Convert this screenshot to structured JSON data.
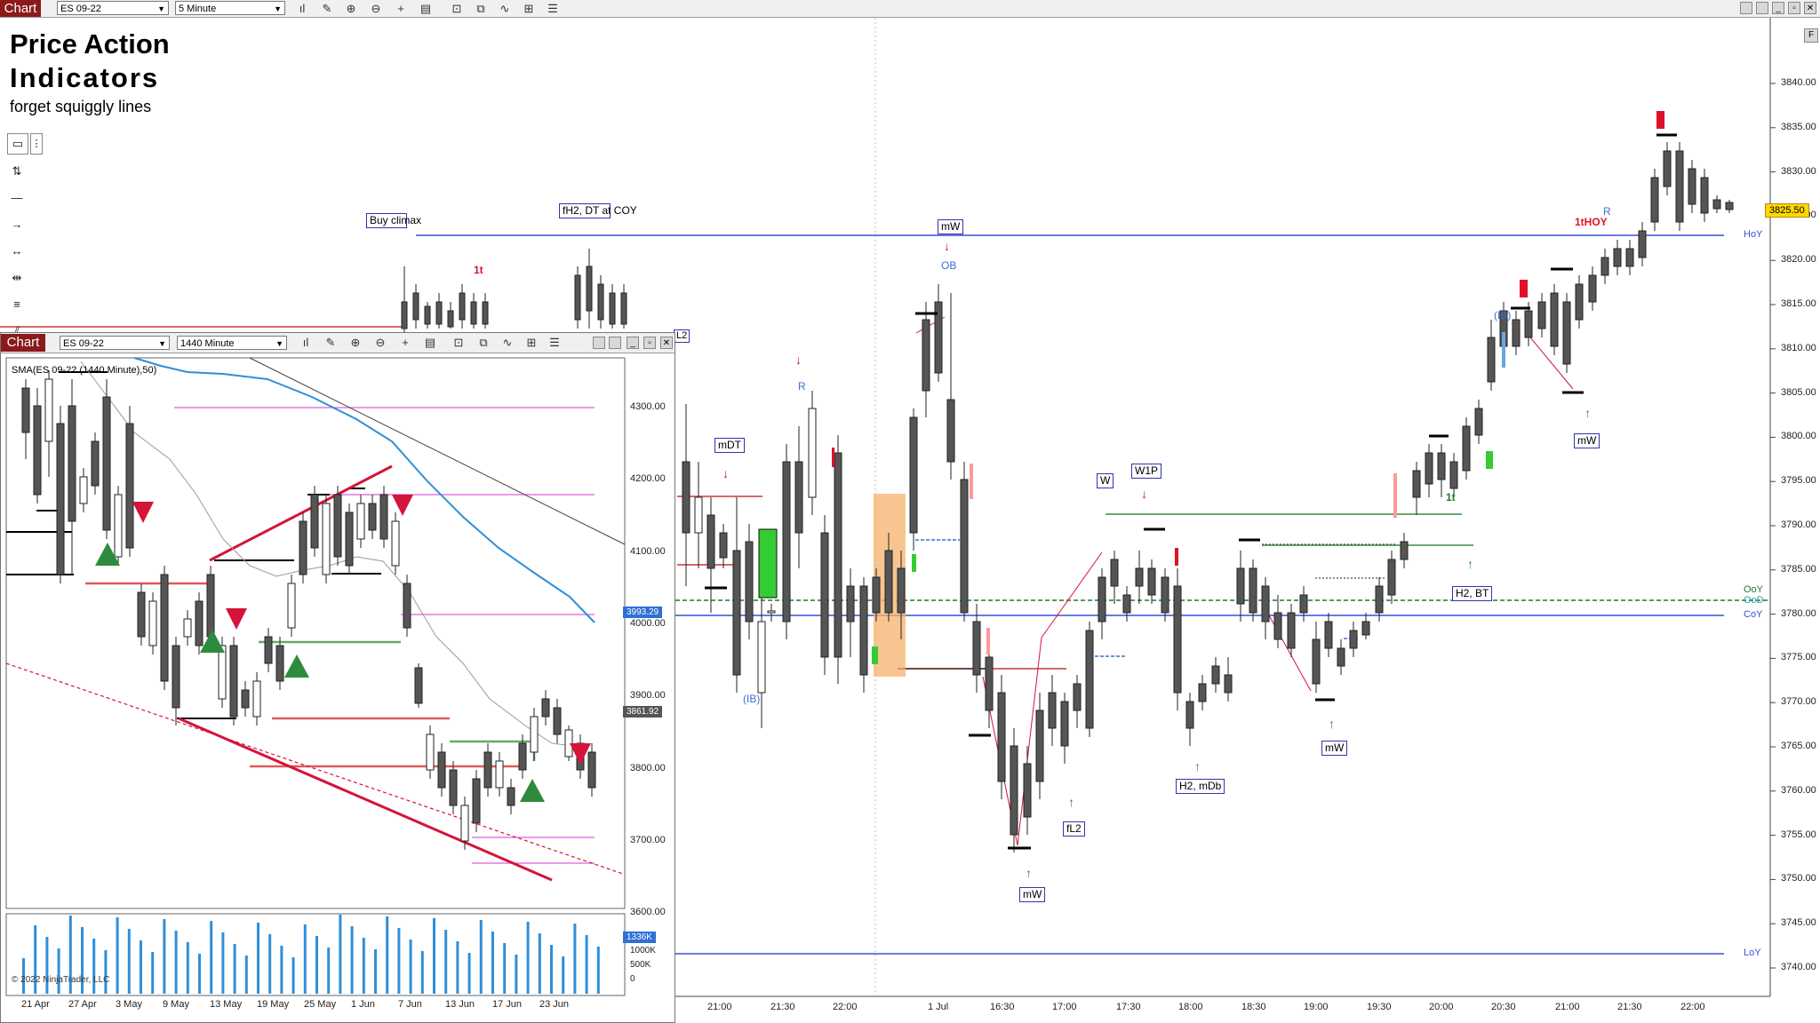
{
  "toolbar": {
    "chart_tab": "Chart",
    "instrument": "ES 09-22",
    "interval": "5 Minute",
    "icons": [
      "bars-icon",
      "pencil-icon",
      "zoom-in-icon",
      "zoom-out-icon",
      "crosshair-icon",
      "properties-icon",
      "data-box-icon",
      "strategies-icon",
      "draw-icon",
      "templates-icon",
      "list-icon"
    ],
    "window_buttons": [
      "restore-icon",
      "tile-icon",
      "minimize-icon",
      "maximize-icon",
      "close-icon"
    ]
  },
  "overlay_title": {
    "line1": "Price Action",
    "line2": "Indicators",
    "line3": "forget squiggly lines"
  },
  "main_chart": {
    "price_labels": [
      "3840.00",
      "3835.00",
      "3830.00",
      "3825.00",
      "3820.00",
      "3815.00",
      "3810.00",
      "3805.00",
      "3800.00",
      "3795.00",
      "3790.00",
      "3785.00",
      "3780.00",
      "3775.00",
      "3770.00",
      "3765.00",
      "3760.00",
      "3755.00",
      "3750.00",
      "3745.00",
      "3740.00"
    ],
    "time_labels": [
      "21:00",
      "21:30",
      "22:00",
      "1 Jul",
      "16:30",
      "17:00",
      "17:30",
      "18:00",
      "18:30",
      "19:00",
      "19:30",
      "20:00",
      "20:30",
      "21:00",
      "21:30",
      "22:00"
    ],
    "current_price": "3825.50",
    "levels": {
      "hoy": "HoY",
      "loy": "LoY",
      "coy": "CoY",
      "ooy": "OoY",
      "ood": "OoD"
    },
    "annotations": {
      "buy_climax": "Buy climax",
      "fh2": "fH2, DT at COY",
      "mw_top": "mW",
      "ob": "OB",
      "one_t_red": "1t",
      "r": "R",
      "mdt": "mDT",
      "ib_left": "(IB)",
      "w": "W",
      "w1p": "W1P",
      "fl2": "fL2",
      "mw_bottom": "mW",
      "h2_mdb": "H2, mDb",
      "mw_mid": "mW",
      "h2_bt": "H2, BT",
      "one_t_green": "1t",
      "ib_right": "(IB)",
      "mw_right": "mW",
      "one_thoy": "1tHOY",
      "r_right": "R",
      "l2_fragment": "L2"
    },
    "colors": {
      "level_line": "#3a4fd6",
      "bull": "#ffffff",
      "bear": "#555555",
      "signal_red": "#d4143a",
      "signal_green": "#2e8b3d",
      "box_orange": "#f6b26b"
    }
  },
  "inset": {
    "chart_tab": "Chart",
    "instrument": "ES 09-22",
    "interval": "1440 Minute",
    "indicator_label": "SMA(ES 09-22 (1440 Minute),50)",
    "price_labels": [
      "4300.00",
      "4200.00",
      "4100.00",
      "4000.00",
      "3900.00",
      "3800.00",
      "3700.00",
      "3600.00"
    ],
    "price_tag_blue": "3993.29",
    "price_tag_gray": "3861.92",
    "volume_labels": [
      "1336K",
      "1000K",
      "500K",
      "0"
    ],
    "date_labels": [
      "21 Apr",
      "27 Apr",
      "3 May",
      "9 May",
      "13 May",
      "19 May",
      "25 May",
      "1 Jun",
      "7 Jun",
      "13 Jun",
      "17 Jun",
      "23 Jun"
    ],
    "copyright": "© 2022 NinjaTrader, LLC"
  }
}
